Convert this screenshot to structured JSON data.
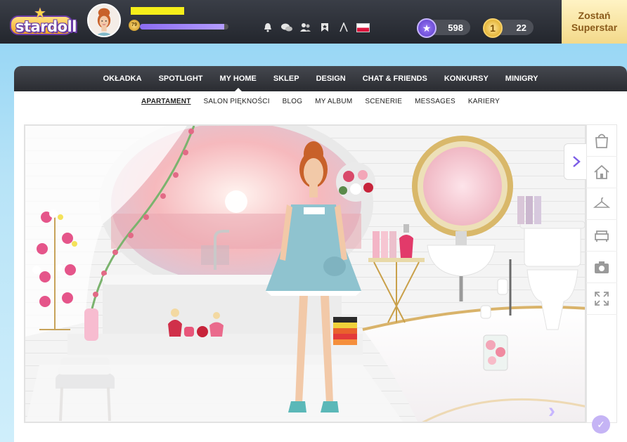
{
  "header": {
    "logo_text": "stardoll",
    "level": "79",
    "xp_percent": 95,
    "stardollars": "598",
    "coins": "22",
    "superstar_line1": "Zostań",
    "superstar_line2": "Superstar",
    "icons": [
      "bell-icon",
      "chat-bubbles-icon",
      "friends-icon",
      "bookmark-icon",
      "vogue-a-icon",
      "poland-flag-icon"
    ]
  },
  "mainnav": {
    "items": [
      "OKŁADKA",
      "SPOTLIGHT",
      "MY HOME",
      "SKLEP",
      "DESIGN",
      "CHAT & FRIENDS",
      "KONKURSY",
      "MINIGRY"
    ],
    "active": "MY HOME"
  },
  "subnav": {
    "items": [
      "APARTAMENT",
      "SALON PIĘKNOŚCI",
      "BLOG",
      "MY ALBUM",
      "SCENERIE",
      "MESSAGES",
      "KARIERY"
    ],
    "active": "APARTAMENT"
  },
  "toolbar": {
    "icons": [
      "shopping-bag-icon",
      "home-icon",
      "hanger-icon",
      "sofa-icon",
      "camera-icon",
      "fullscreen-icon"
    ]
  },
  "colors": {
    "accent": "#7b5ce6",
    "topbar": "#2a2c31",
    "superstar_bg": "#f3d98a"
  }
}
